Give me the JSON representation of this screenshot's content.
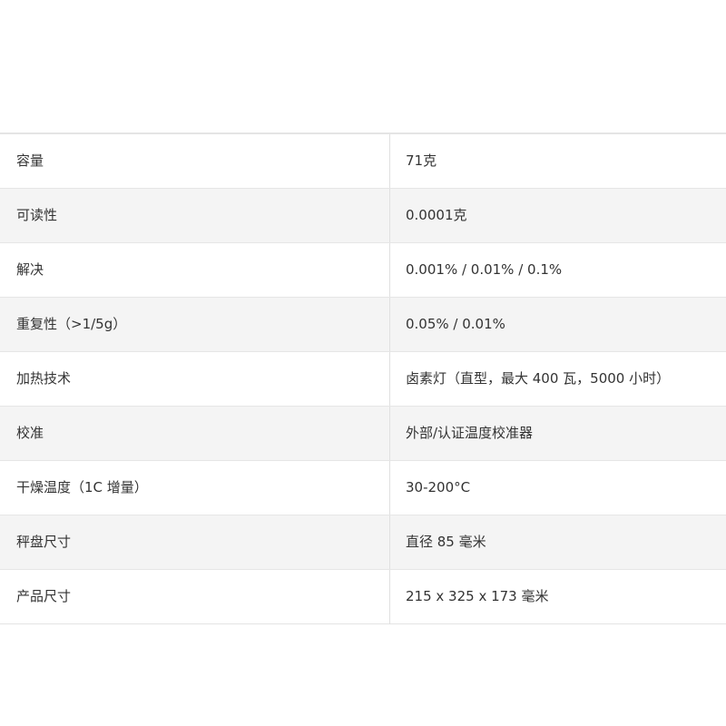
{
  "spec_table": {
    "rows": [
      {
        "label": "容量",
        "value": "71克"
      },
      {
        "label": "可读性",
        "value": "0.0001克"
      },
      {
        "label": "解决",
        "value": "0.001% / 0.01% / 0.1%"
      },
      {
        "label": "重复性（>1/5g）",
        "value": "0.05% / 0.01%"
      },
      {
        "label": "加热技术",
        "value": "卤素灯（直型，最大 400 瓦，5000 小时）"
      },
      {
        "label": "校准",
        "value": "外部/认证温度校准器"
      },
      {
        "label": "干燥温度（1C 增量）",
        "value": "30-200°C"
      },
      {
        "label": "秤盘尺寸",
        "value": "直径 85 毫米"
      },
      {
        "label": "产品尺寸",
        "value": "215 x 325 x 173 毫米"
      }
    ]
  }
}
